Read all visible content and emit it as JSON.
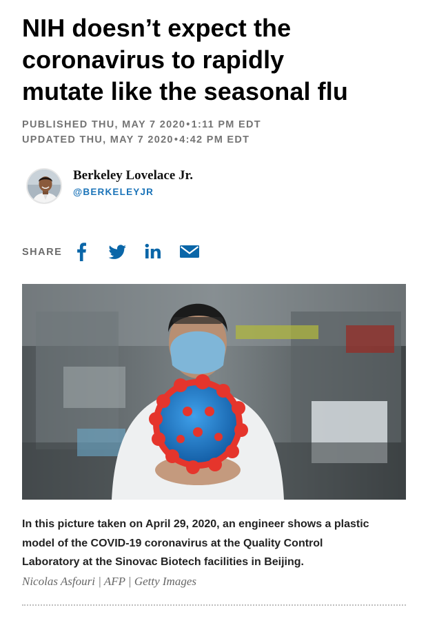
{
  "article": {
    "headline_lines": [
      "NIH doesn’t expect the",
      "coronavirus to rapidly",
      "mutate like the seasonal flu"
    ],
    "published": {
      "label": "PUBLISHED THU, MAY 7 2020",
      "separator": "•",
      "time": "1:11 PM EDT"
    },
    "updated": {
      "label": "UPDATED THU, MAY 7 2020",
      "separator": "•",
      "time": "4:42 PM EDT"
    }
  },
  "author": {
    "name": "Berkeley Lovelace Jr.",
    "handle": "@BERKELEYJR"
  },
  "share": {
    "label": "SHARE",
    "icons": [
      "facebook-icon",
      "twitter-icon",
      "linkedin-icon",
      "email-icon"
    ]
  },
  "image": {
    "caption_lines": [
      "In this picture taken on April 29, 2020, an engineer shows a plastic",
      "model of the COVID-19 coronavirus at the Quality Control",
      "Laboratory at the Sinovac Biotech facilities in Beijing."
    ],
    "credit": "Nicolas Asfouri | AFP | Getty Images"
  },
  "colors": {
    "handle_blue": "#1a73b8",
    "share_icon_blue": "#0a66a8",
    "meta_gray": "#747474"
  }
}
